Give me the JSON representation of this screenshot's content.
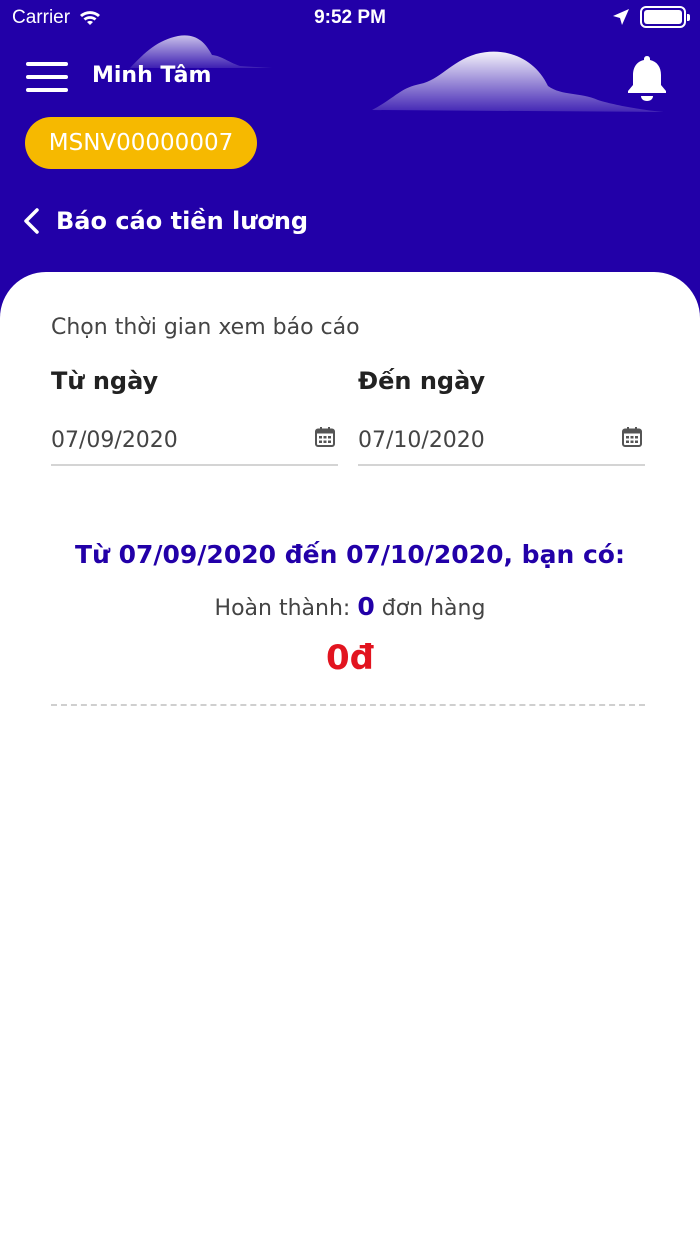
{
  "status_bar": {
    "carrier": "Carrier",
    "time": "9:52 PM"
  },
  "header": {
    "user_name": "Minh Tâm",
    "employee_code": "MSNV00000007",
    "page_title": "Báo cáo tiền lương"
  },
  "report": {
    "subtitle": "Chọn thời gian xem báo cáo",
    "from_label": "Từ ngày",
    "from_value": "07/09/2020",
    "to_label": "Đến ngày",
    "to_value": "07/10/2020",
    "summary": "Từ 07/09/2020 đến 07/10/2020, bạn có:",
    "completed_prefix": "Hoàn thành:",
    "completed_count": "0",
    "completed_suffix": "đơn hàng",
    "amount": "0đ"
  },
  "colors": {
    "primary": "#2200A8",
    "badge": "#F6B900",
    "amount": "#E2141F"
  },
  "icons": [
    "wifi-icon",
    "location-arrow-icon",
    "battery-icon",
    "menu-icon",
    "bell-icon",
    "back-icon",
    "calendar-icon"
  ]
}
